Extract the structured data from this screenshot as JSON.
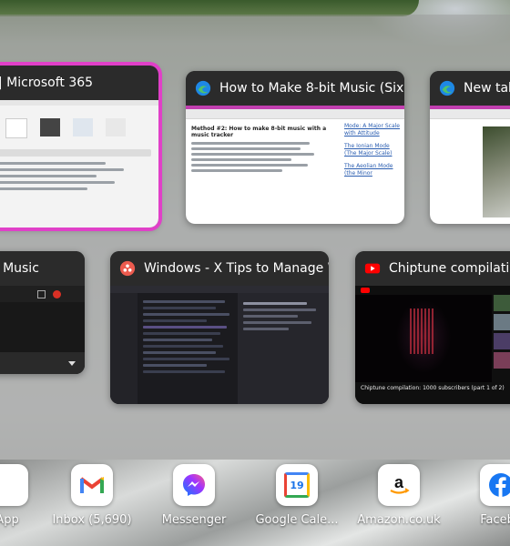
{
  "windows": [
    {
      "title": "| Microsoft 365",
      "icon": "microsoft-365-icon"
    },
    {
      "title": "How to Make 8-bit Music (Six...",
      "icon": "edge-icon"
    },
    {
      "title": "New tab",
      "icon": "edge-icon"
    },
    {
      "title": "e Music",
      "icon": "music-app-icon"
    },
    {
      "title": "Windows - X Tips to Manage W...",
      "icon": "app-dots-icon"
    },
    {
      "title": "Chiptune compilation: ",
      "icon": "youtube-icon"
    }
  ],
  "article": {
    "heading": "Method #2: How to make 8-bit music with a music tracker",
    "sidebar_links": [
      "Mode: A Major Scale with Attitude",
      "The Ionian Mode (The Major Scale)",
      "The Aeolian Mode (the Minor"
    ]
  },
  "video": {
    "caption": "Chiptune compilation: 1000 subscribers (part 1 of 2)"
  },
  "dock": [
    {
      "label": "App",
      "icon": "app-icon"
    },
    {
      "label": "Inbox (5,690)",
      "icon": "gmail-icon"
    },
    {
      "label": "Messenger",
      "icon": "messenger-icon"
    },
    {
      "label": "Google Cale...",
      "icon": "google-calendar-icon",
      "calendar_day": "19"
    },
    {
      "label": "Amazon.co.uk",
      "icon": "amazon-icon"
    },
    {
      "label": "Facebo",
      "icon": "facebook-icon"
    }
  ]
}
